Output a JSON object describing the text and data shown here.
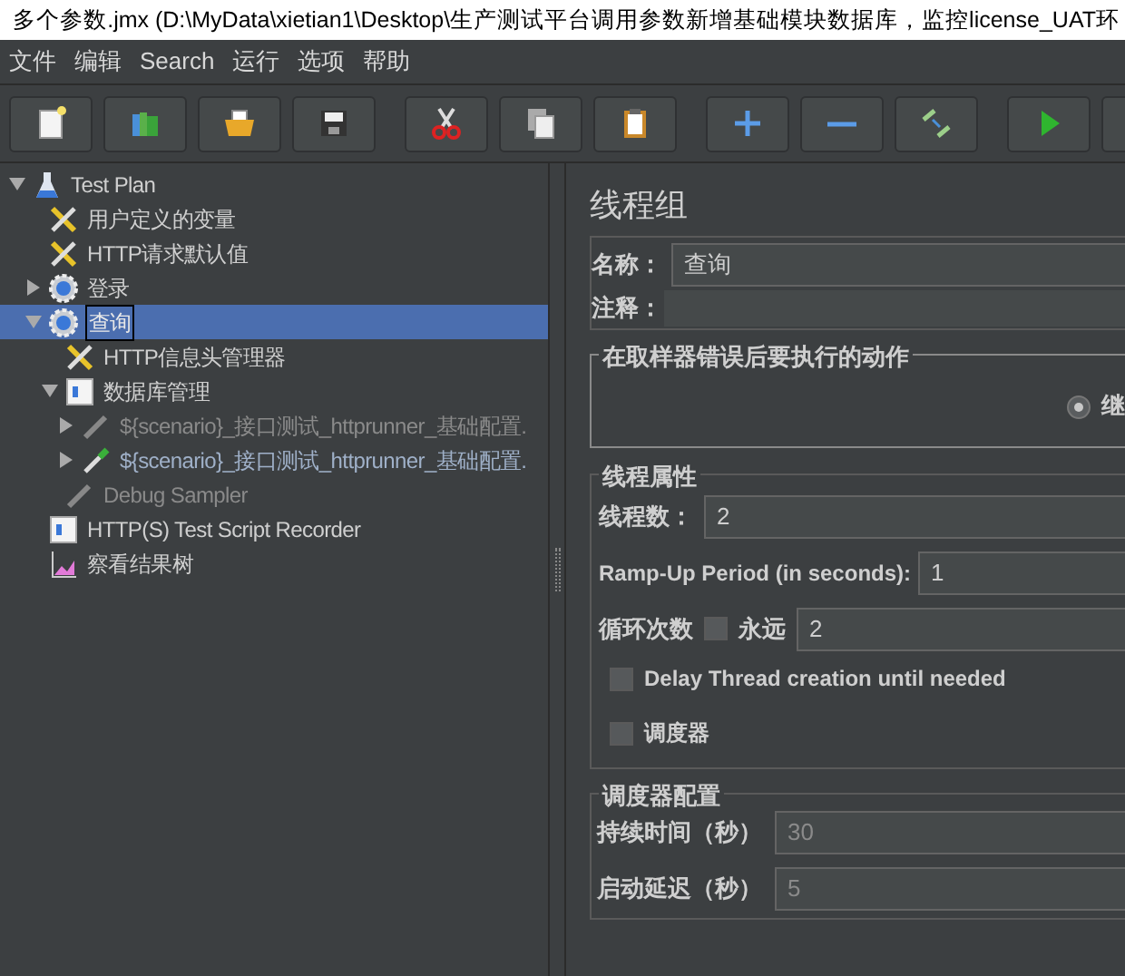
{
  "window": {
    "title": "多个参数.jmx (D:\\MyData\\xietian1\\Desktop\\生产测试平台调用参数新增基础模块数据库，监控license_UAT环"
  },
  "menu": [
    "文件",
    "编辑",
    "Search",
    "运行",
    "选项",
    "帮助"
  ],
  "toolbar": [
    {
      "kind": "new"
    },
    {
      "kind": "templates"
    },
    {
      "kind": "open"
    },
    {
      "kind": "save"
    },
    {
      "kind": "cut"
    },
    {
      "kind": "copy"
    },
    {
      "kind": "paste"
    },
    {
      "kind": "expand"
    },
    {
      "kind": "collapse"
    },
    {
      "kind": "toggle"
    },
    {
      "kind": "start"
    },
    {
      "kind": "more"
    }
  ],
  "tree": [
    {
      "label": "Test Plan",
      "kind": "plan",
      "expanded": true,
      "selected": false,
      "disabled": false,
      "children": [
        {
          "label": "用户定义的变量",
          "kind": "config",
          "selected": false,
          "disabled": false
        },
        {
          "label": "HTTP请求默认值",
          "kind": "config",
          "selected": false,
          "disabled": false
        },
        {
          "label": "登录",
          "kind": "thread-group",
          "expanded": false,
          "selected": false,
          "disabled": false
        },
        {
          "label": "查询",
          "kind": "thread-group",
          "expanded": true,
          "selected": true,
          "disabled": false,
          "children": [
            {
              "label": "HTTP信息头管理器",
              "kind": "config",
              "selected": false,
              "disabled": false
            },
            {
              "label": "数据库管理",
              "kind": "controller",
              "expanded": true,
              "selected": false,
              "disabled": false,
              "children": [
                {
                  "label": "${scenario}_接口测试_httprunner_基础配置.",
                  "kind": "sampler",
                  "expanded": false,
                  "selected": false,
                  "disabled": true
                },
                {
                  "label": "${scenario}_接口测试_httprunner_基础配置.",
                  "kind": "sampler-active",
                  "expanded": false,
                  "selected": false,
                  "disabled": false
                }
              ]
            },
            {
              "label": "Debug Sampler",
              "kind": "sampler",
              "selected": false,
              "disabled": true
            }
          ]
        },
        {
          "label": "HTTP(S) Test Script Recorder",
          "kind": "controller",
          "selected": false,
          "disabled": false
        },
        {
          "label": "察看结果树",
          "kind": "listener",
          "selected": false,
          "disabled": false
        }
      ]
    }
  ],
  "panel": {
    "title": "线程组",
    "name": {
      "label": "名称：",
      "value": "查询"
    },
    "comment": {
      "label": "注释："
    },
    "on_error": {
      "legend": "在取样器错误后要执行的动作",
      "options": [
        {
          "label": "继",
          "selected": true
        }
      ]
    },
    "thread_props": {
      "legend": "线程属性",
      "threads": {
        "label": "线程数：",
        "value": "2"
      },
      "ramp_up": {
        "label": "Ramp-Up Period (in seconds):",
        "value": "1"
      },
      "loop": {
        "label": "循环次数",
        "forever_label": "永远",
        "forever_checked": false,
        "value": "2"
      },
      "checkboxes": [
        {
          "label": "Delay Thread creation until needed",
          "checked": false
        },
        {
          "label": "调度器",
          "checked": false
        }
      ]
    },
    "scheduler": {
      "legend": "调度器配置",
      "fields": [
        {
          "label": "持续时间（秒）",
          "value": "30",
          "disabled": true
        },
        {
          "label": "启动延迟（秒）",
          "value": "5",
          "disabled": true
        }
      ]
    }
  }
}
